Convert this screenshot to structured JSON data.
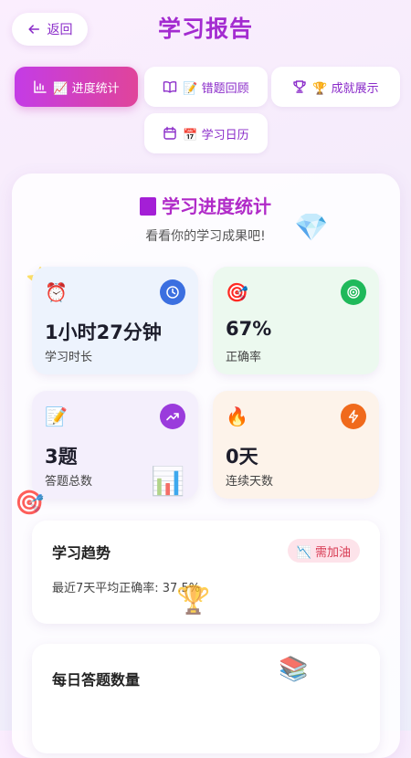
{
  "header": {
    "back_label": "返回",
    "title": "学习报告"
  },
  "tabs": [
    {
      "label": "📈 进度统计",
      "icon": "bar-chart-icon",
      "active": true
    },
    {
      "label": "📝 错题回顾",
      "icon": "book-icon",
      "active": false
    },
    {
      "label": "🏆 成就展示",
      "icon": "trophy-icon",
      "active": false
    },
    {
      "label": "📅 学习日历",
      "icon": "calendar-icon",
      "active": false
    }
  ],
  "panel": {
    "title": "学习进度统计",
    "subtitle": "看看你的学习成果吧!"
  },
  "stats": [
    {
      "emoji": "⏰",
      "value": "1小时27分钟",
      "label": "学习时长",
      "badge_icon": "clock-icon",
      "badge_color": "#3b6fe0",
      "bg": "#edf3fd"
    },
    {
      "emoji": "🎯",
      "value": "67%",
      "label": "正确率",
      "badge_icon": "target-icon",
      "badge_color": "#1fb95a",
      "bg": "#ecf9ef"
    },
    {
      "emoji": "📝",
      "value": "3题",
      "label": "答题总数",
      "badge_icon": "trend-up-icon",
      "badge_color": "#9a3bdc",
      "bg": "#f4effc"
    },
    {
      "emoji": "🔥",
      "value": "0天",
      "label": "连续天数",
      "badge_icon": "lightning-icon",
      "badge_color": "#f06a1c",
      "bg": "#fdf3ea"
    }
  ],
  "trend": {
    "title": "学习趋势",
    "badge": "📉 需加油",
    "summary": "最近7天平均正确率: 37.5%"
  },
  "daily": {
    "title": "每日答题数量"
  },
  "decorations": [
    "⭐",
    "🎯",
    "📊",
    "🏆",
    "📚",
    "💎"
  ]
}
